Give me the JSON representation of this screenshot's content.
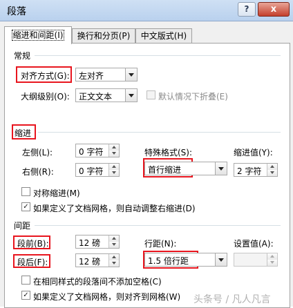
{
  "window": {
    "title": "段落",
    "help_icon": "?",
    "close_icon": "x"
  },
  "tabs": [
    {
      "label": "缩进和间距(I)",
      "active": true
    },
    {
      "label": "换行和分页(P)",
      "active": false
    },
    {
      "label": "中文版式(H)",
      "active": false
    }
  ],
  "general": {
    "title": "常规",
    "alignment_label": "对齐方式(G):",
    "alignment_value": "左对齐",
    "outline_label": "大纲级别(O):",
    "outline_value": "正文文本",
    "collapse_label": "默认情况下折叠(E)"
  },
  "indent": {
    "title": "缩进",
    "left_label": "左侧(L):",
    "left_value": "0 字符",
    "right_label": "右侧(R):",
    "right_value": "0 字符",
    "special_label": "特殊格式(S):",
    "special_value": "首行缩进",
    "by_label": "缩进值(Y):",
    "by_value": "2 字符",
    "mirror_label": "对称缩进(M)",
    "auto_adjust_label": "如果定义了文档网格，则自动调整右缩进(D)"
  },
  "spacing": {
    "title": "间距",
    "before_label": "段前(B):",
    "before_value": "12 磅",
    "after_label": "段后(F):",
    "after_value": "12 磅",
    "line_label": "行距(N):",
    "line_value": "1.5 倍行距",
    "at_label": "设置值(A):",
    "at_value": "",
    "no_space_label": "在相同样式的段落间不添加空格(C)",
    "snap_grid_label": "如果定义了文档网格，则对齐到网格(W)"
  },
  "checks": {
    "mark": "✓"
  },
  "watermark": "头条号 / 凡人凡言",
  "colors": {
    "highlight": "#e8141d",
    "titlebar": "#c4d8f0",
    "close_button": "#c4402d"
  }
}
